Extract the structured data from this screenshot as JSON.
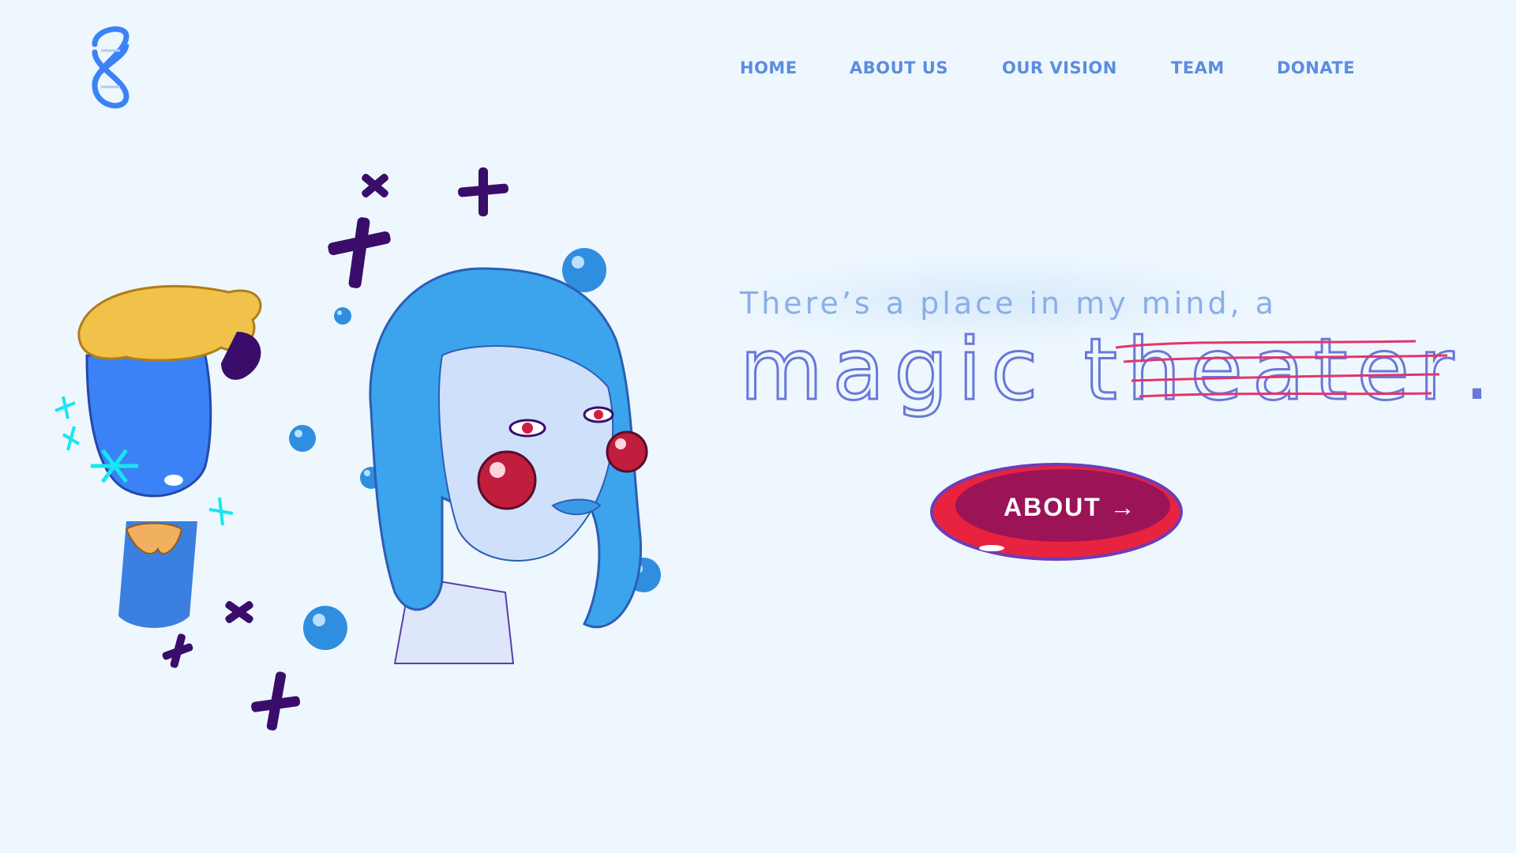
{
  "logo": {
    "icon": "dna-helix-icon",
    "color": "#3b82f6"
  },
  "nav": {
    "items": [
      {
        "label": "HOME"
      },
      {
        "label": "ABOUT US"
      },
      {
        "label": "OUR VISION"
      },
      {
        "label": "TEAM"
      },
      {
        "label": "DONATE"
      }
    ],
    "color": "#5b8dde"
  },
  "hero": {
    "tagline": "There’s a place in my mind, a",
    "headline_word1": "magic",
    "headline_word2_first": "t",
    "headline_word2_struck": "heater",
    "headline_end": ".",
    "strike_color": "#e2366b"
  },
  "cta": {
    "label": "ABOUT",
    "arrow": "→",
    "color": "#9b1457",
    "ring_color": "#e8233f"
  },
  "illustration": {
    "icons": [
      "blue-haired-woman-illustration",
      "melting-head-illustration",
      "cross-sparkle-icon",
      "blue-bubble-icon"
    ]
  }
}
